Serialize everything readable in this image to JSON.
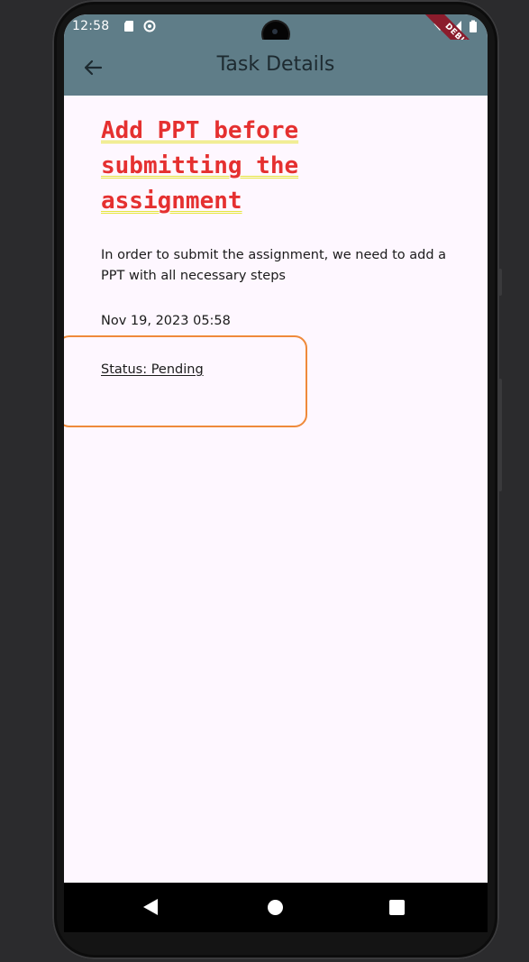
{
  "status_bar": {
    "time": "12:58",
    "icons": [
      "sd-card-icon",
      "sync-icon",
      "wifi-icon",
      "signal-icon",
      "battery-icon"
    ]
  },
  "app_bar": {
    "title": "Task Details",
    "back_icon": "arrow-back-icon",
    "debug_banner": "DEBUG",
    "background": "#5f7d88"
  },
  "task": {
    "title": "Add PPT before submitting the assignment",
    "description": "In order to submit the assignment, we need to add a PPT with all necessary steps",
    "date": "Nov 19, 2023 05:58",
    "status": "Status: Pending",
    "title_color": "#e53030",
    "highlight_color": "#ef8a3b"
  },
  "nav_bar": {
    "icons": [
      "nav-back-icon",
      "nav-home-icon",
      "nav-recents-icon"
    ]
  }
}
